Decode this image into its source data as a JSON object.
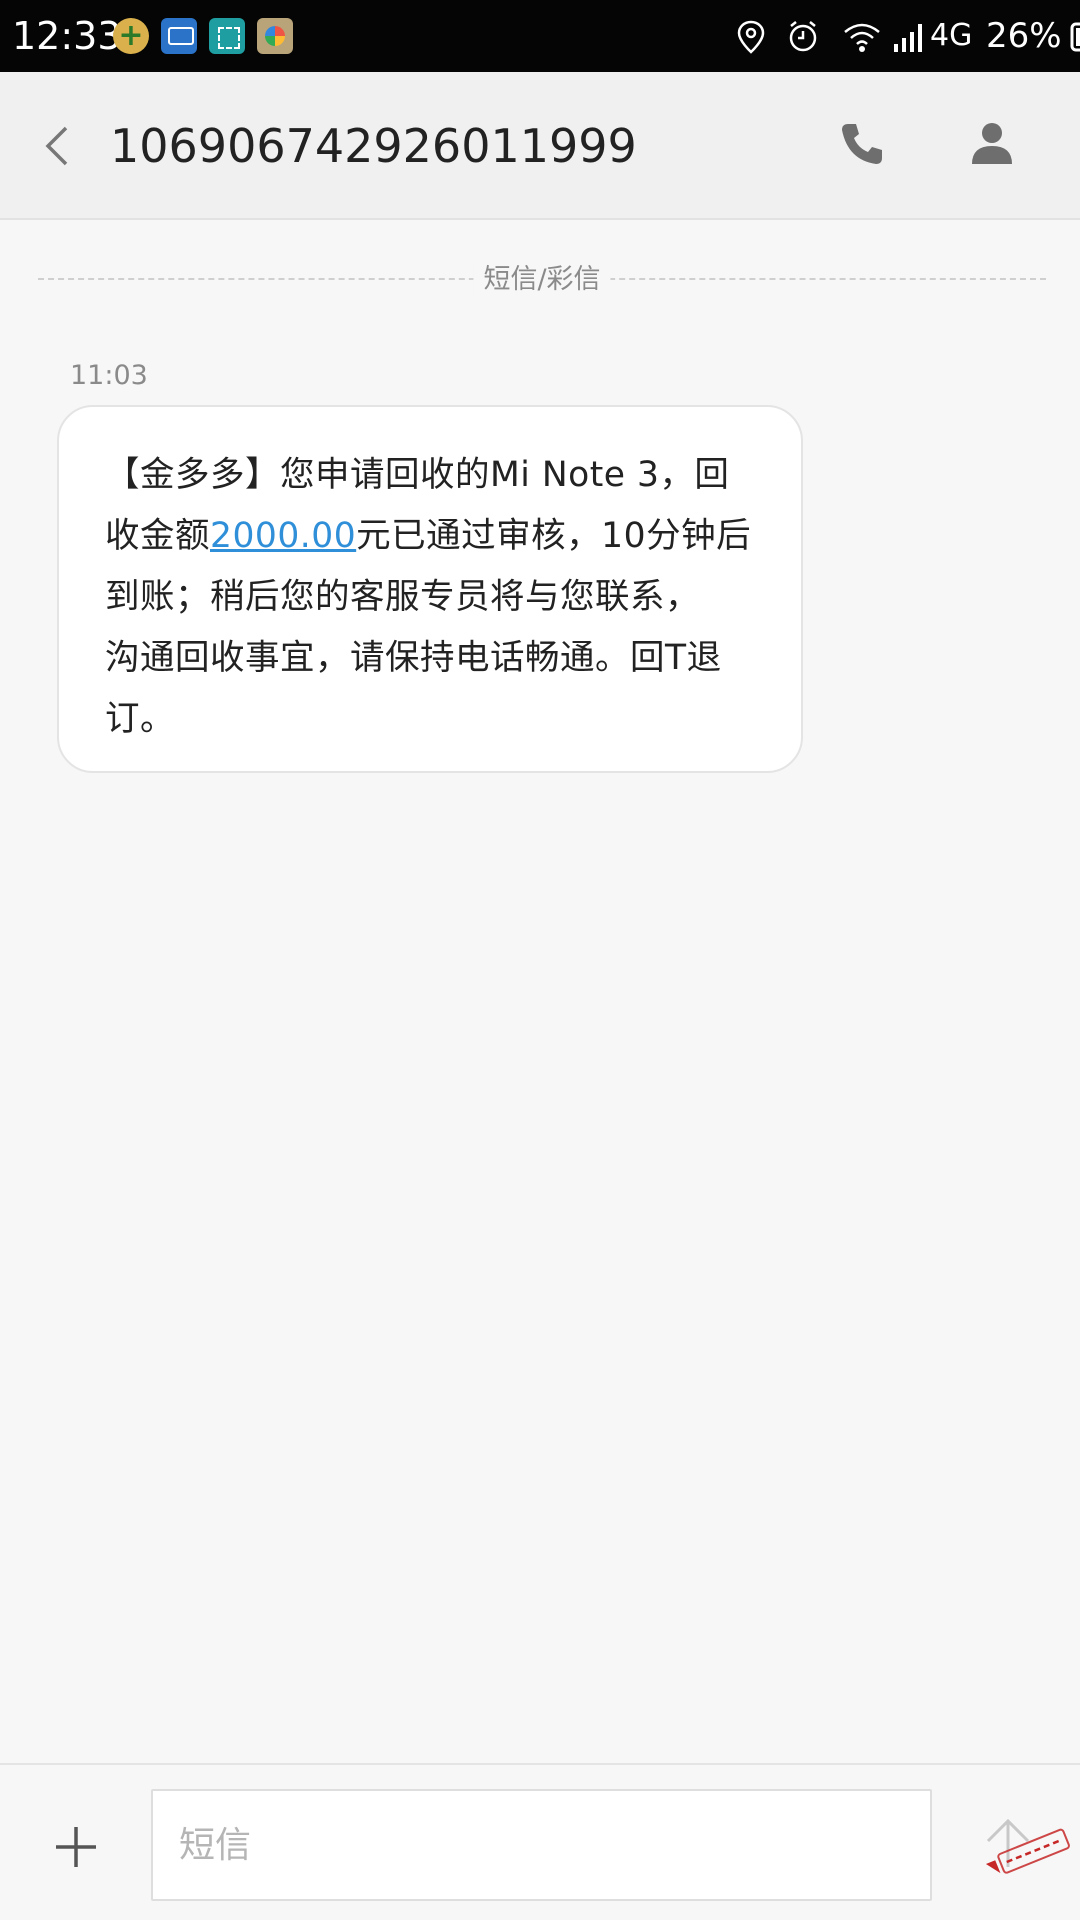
{
  "status_bar": {
    "time": "12:33",
    "network": "4G",
    "battery": "26%",
    "notification_icons": [
      "add-app-icon",
      "chat-icon",
      "scan-icon",
      "photo-app-icon"
    ],
    "system_icons": [
      "location-icon",
      "alarm-icon",
      "wifi-icon",
      "signal-icon",
      "battery-icon"
    ]
  },
  "header": {
    "contact": "10690674292601199 9",
    "actions": [
      "call-icon",
      "contact-profile-icon"
    ]
  },
  "thread": {
    "divider_label": "短信/彩信",
    "messages": [
      {
        "time": "11:03",
        "lines": [
          [
            "【金多多】您申请回收的Mi Note 3，回"
          ],
          [
            "收金额",
            "2000.00",
            "元已通过审核，10分钟后"
          ],
          [
            "到账；稍后您的客服专员将与您联系，"
          ],
          [
            "沟通回收事宜，请保持电话畅通。回T退"
          ],
          [
            "订。"
          ]
        ],
        "amount_link": "2000.00"
      }
    ]
  },
  "composer": {
    "placeholder": "短信",
    "value": ""
  },
  "colors": {
    "status_bar_bg": "#050505",
    "header_bg": "#f0f0f0",
    "background": "#f7f7f7",
    "bubble_bg": "#ffffff",
    "link": "#2f8fd8"
  }
}
